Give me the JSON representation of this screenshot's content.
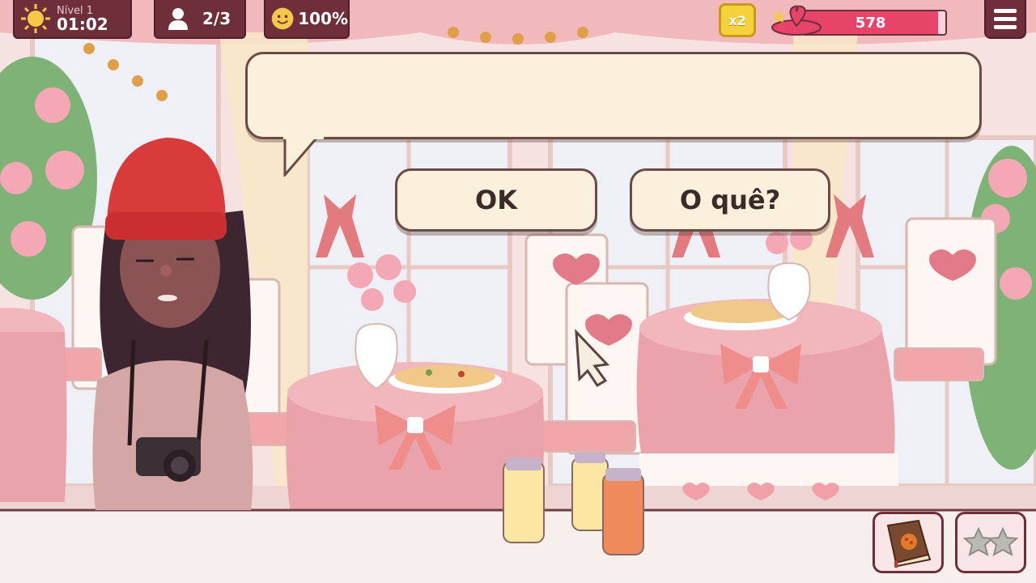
{
  "hud": {
    "level_label": "Nível 1",
    "time": "01:02",
    "customers": "2/3",
    "satisfaction": "100%",
    "multiplier": "x2",
    "hearts_value": "578"
  },
  "dialog": {
    "text": "",
    "choices": [
      "OK",
      "O quê?"
    ]
  },
  "icons": {
    "sun": "sun-icon",
    "customer": "customer-icon",
    "smiley": "smiley-icon",
    "multiplier": "multiplier-badge",
    "heart": "heart-bowl-icon",
    "menu": "menu-icon",
    "recipe_book": "recipe-book-icon",
    "stars": "stars-icon"
  },
  "colors": {
    "hud_bg": "#6e2f3a",
    "progress_fill": "#e8446a",
    "bubble_bg": "#fbf0dc",
    "hat": "#d93a3a"
  },
  "progress": {
    "hearts_fill_fraction": 0.95
  }
}
